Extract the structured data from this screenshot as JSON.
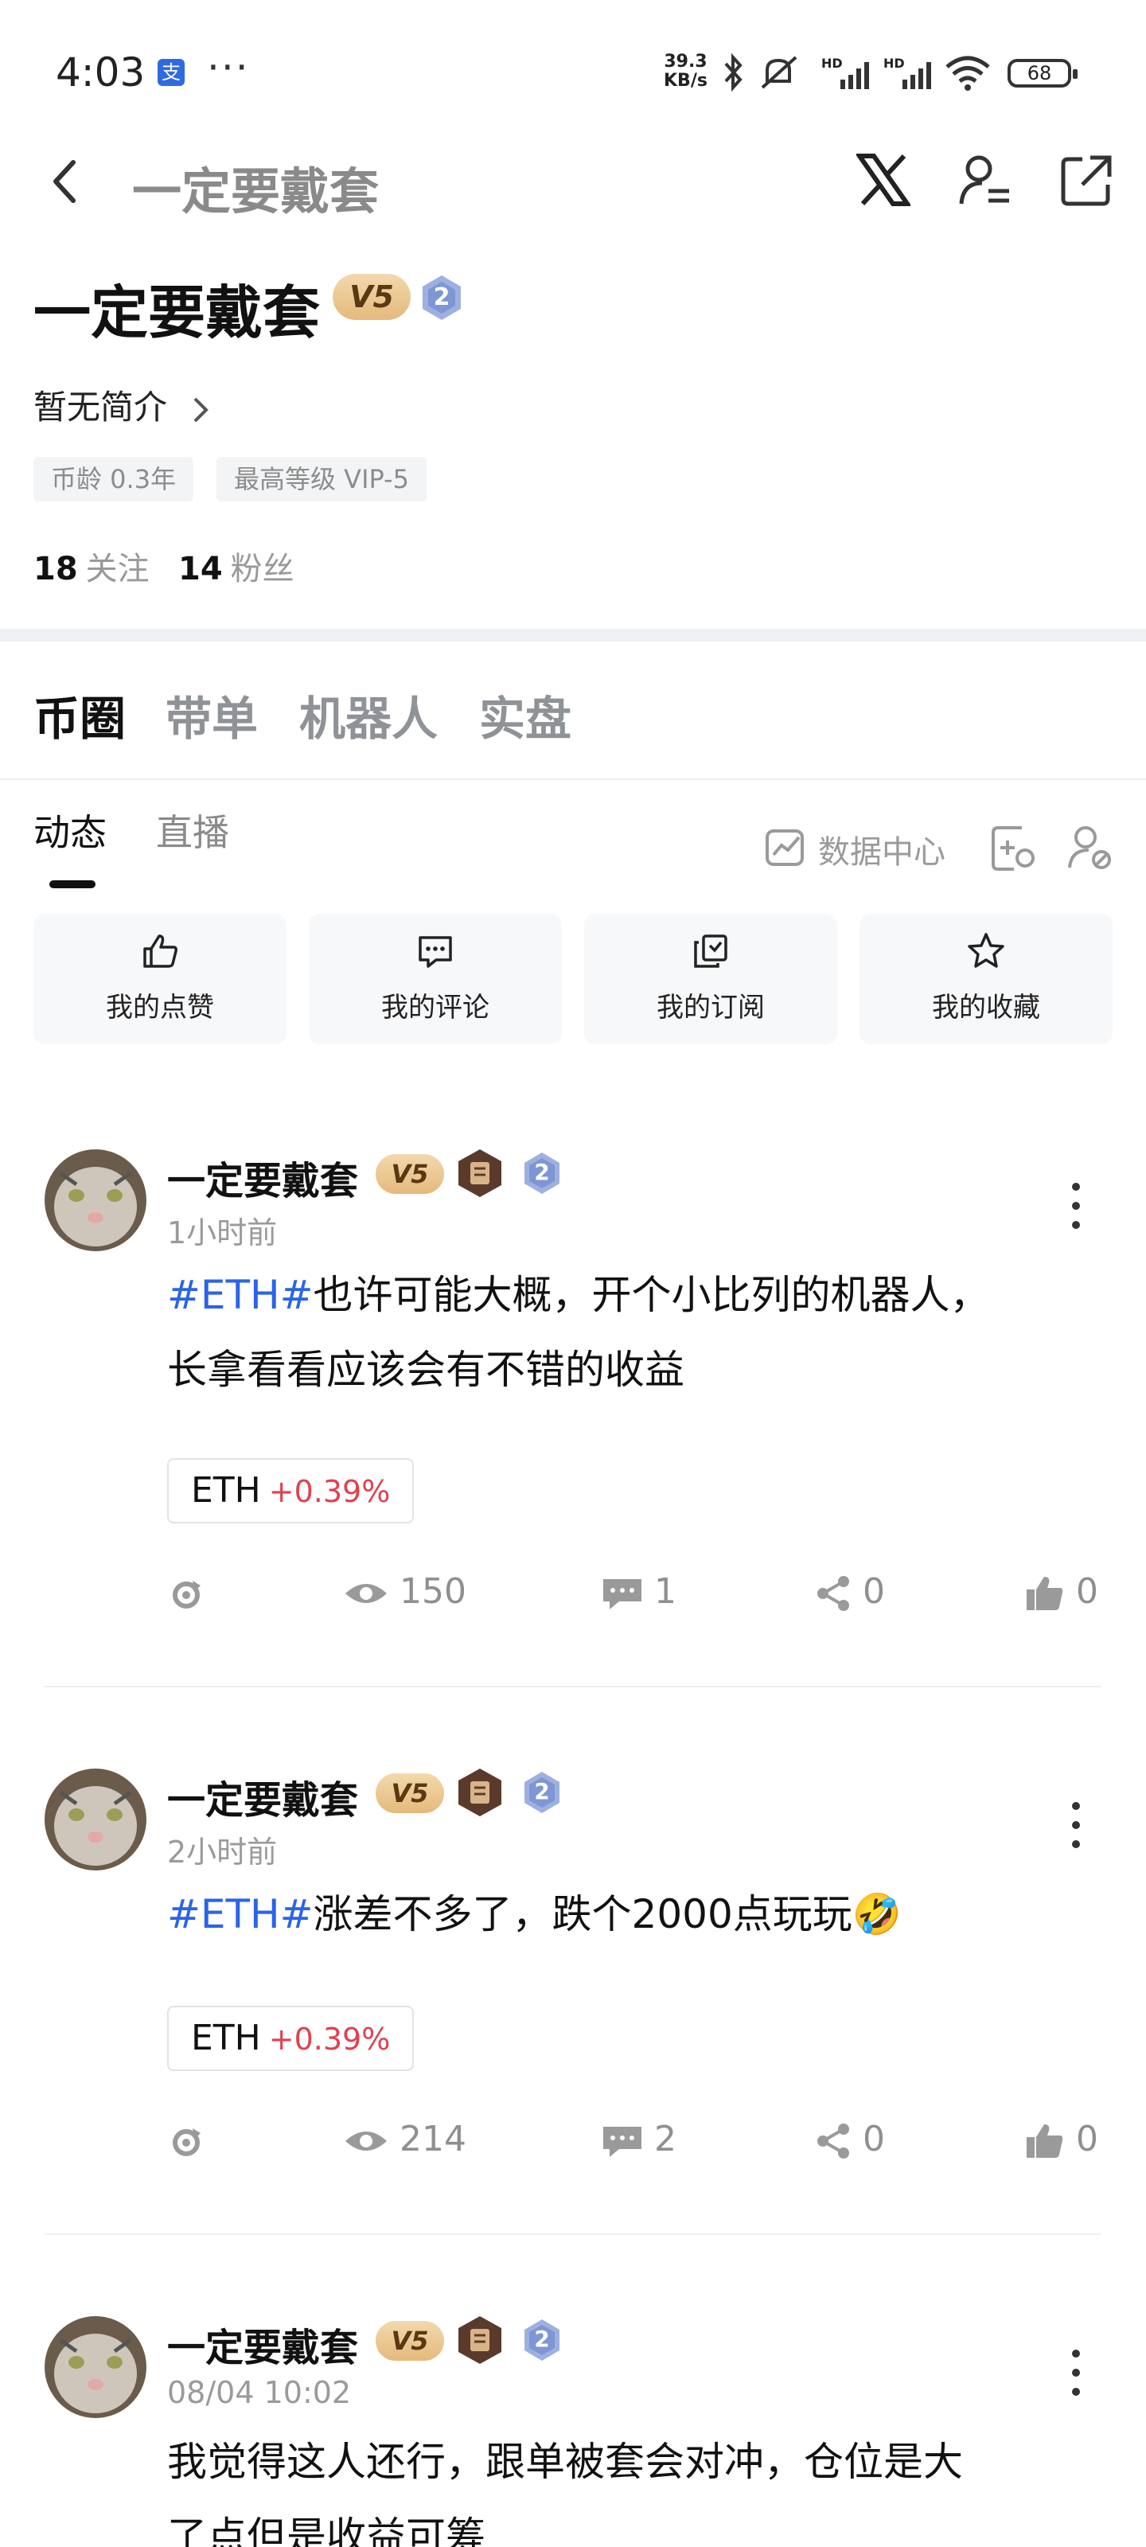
{
  "status_bar": {
    "time": "4:03",
    "app_icon_glyph": "支",
    "dots": "···",
    "net_speed_value": "39.3",
    "net_speed_unit": "KB/s",
    "network_labels": [
      "HD",
      "HD"
    ],
    "battery": "68"
  },
  "nav": {
    "title": "一定要戴套",
    "icons": [
      "back-arrow-icon",
      "x-logo-icon",
      "user-settings-icon",
      "share-external-icon"
    ]
  },
  "profile": {
    "name": "一定要戴套",
    "vip_badge": "V5",
    "level_badge": "2",
    "intro": "暂无简介",
    "tags": [
      "币龄 0.3年",
      "最高等级 VIP-5"
    ],
    "following_count": "18",
    "following_label": "关注",
    "followers_count": "14",
    "followers_label": "粉丝"
  },
  "main_tabs": [
    {
      "label": "币圈",
      "active": true
    },
    {
      "label": "带单",
      "active": false
    },
    {
      "label": "机器人",
      "active": false
    },
    {
      "label": "实盘",
      "active": false
    }
  ],
  "sub_tabs": [
    {
      "label": "动态",
      "active": true
    },
    {
      "label": "直播",
      "active": false
    }
  ],
  "data_center_label": "数据中心",
  "quick_actions": [
    {
      "label": "我的点赞",
      "icon": "thumbs-up-icon"
    },
    {
      "label": "我的评论",
      "icon": "comment-icon"
    },
    {
      "label": "我的订阅",
      "icon": "subscription-icon"
    },
    {
      "label": "我的收藏",
      "icon": "star-icon"
    }
  ],
  "posts": [
    {
      "author": "一定要戴套",
      "vip_badge": "V5",
      "level_badge": "2",
      "time": "1小时前",
      "hashtag": "#ETH#",
      "text_line1": "也许可能大概，开个小比列的机器人，",
      "text_line2": "长拿看看应该会有不错的收益",
      "chip_symbol": "ETH",
      "chip_change": "+0.39%",
      "views": "150",
      "comments": "1",
      "shares": "0",
      "likes": "0"
    },
    {
      "author": "一定要戴套",
      "vip_badge": "V5",
      "level_badge": "2",
      "time": "2小时前",
      "hashtag": "#ETH#",
      "text_line1": "涨差不多了，跌个2000点玩玩🤣",
      "chip_symbol": "ETH",
      "chip_change": "+0.39%",
      "views": "214",
      "comments": "2",
      "shares": "0",
      "likes": "0"
    },
    {
      "author": "一定要戴套",
      "vip_badge": "V5",
      "level_badge": "2",
      "time": "08/04 10:02",
      "text_line1": "我觉得这人还行，跟单被套会对冲，仓位是大",
      "text_line2": "了点但是收益可筹"
    }
  ],
  "colors": {
    "hashtag": "#2a64e8",
    "price_up": "#e0414e",
    "muted": "#8a8a8a",
    "vip_gold": "#e5b97c",
    "level_blue": "#9db0e0"
  }
}
